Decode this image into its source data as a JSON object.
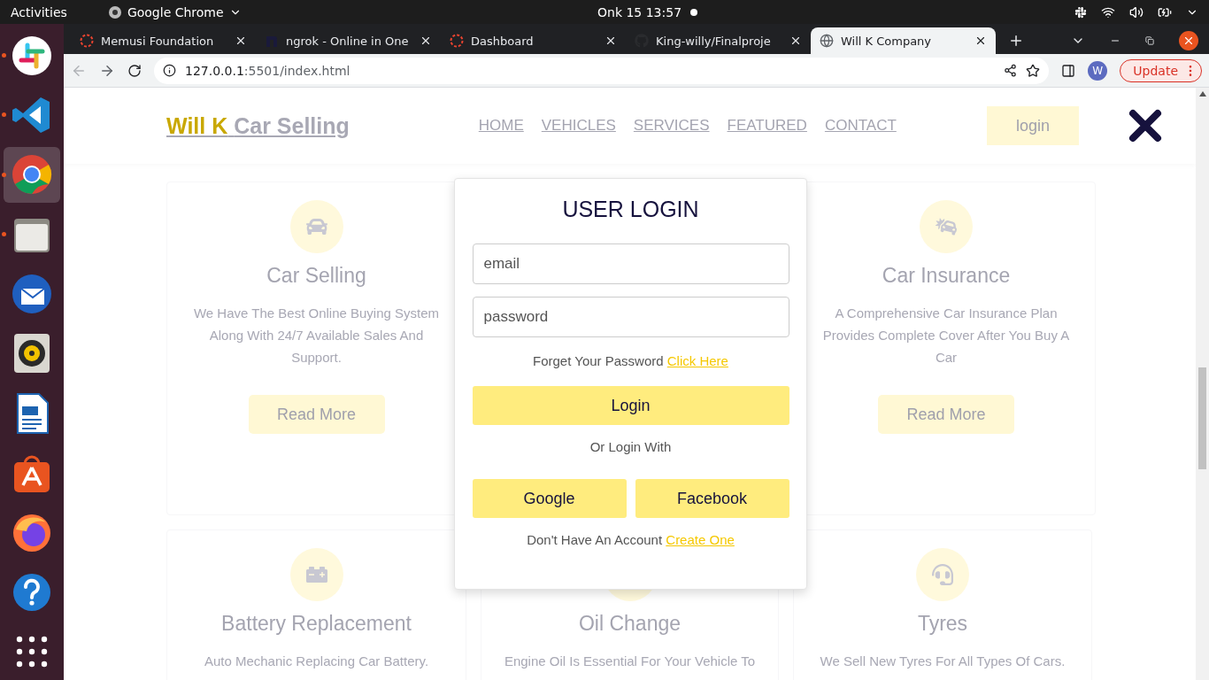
{
  "topbar": {
    "activities": "Activities",
    "app": "Google Chrome",
    "clock": "Onk 15  13:57"
  },
  "dock": [
    {
      "running": true,
      "selected": false
    },
    {
      "running": true,
      "selected": false
    },
    {
      "running": true,
      "selected": true
    },
    {
      "running": true,
      "selected": false
    },
    {
      "running": false,
      "selected": false
    },
    {
      "running": false,
      "selected": false
    },
    {
      "running": false,
      "selected": false
    },
    {
      "running": false,
      "selected": false
    },
    {
      "running": false,
      "selected": false
    },
    {
      "running": false,
      "selected": false
    },
    {
      "running": false,
      "selected": false
    }
  ],
  "tabs": [
    {
      "title": "Memusi Foundation",
      "selected": false
    },
    {
      "title": "ngrok - Online in One",
      "selected": false
    },
    {
      "title": "Dashboard",
      "selected": false
    },
    {
      "title": "King-willy/Finalproje",
      "selected": false
    },
    {
      "title": "Will K Company",
      "selected": true
    }
  ],
  "toolbar": {
    "host": "127.0.0.1",
    "path": ":5501/index.html",
    "avatar": "W",
    "update": "Update"
  },
  "header": {
    "logo_accent": "Will K",
    "logo_rest": "Car Selling",
    "nav": [
      "HOME",
      "VEHICLES",
      "SERVICES",
      "FEATURED",
      "CONTACT"
    ],
    "login": "login"
  },
  "cards_top": [
    {
      "kind": "service",
      "title": "Car Selling",
      "text": "We Have The Best Online Buying System Along With 24/7 Available Sales And Support.",
      "button": "Read More"
    },
    {
      "kind": "service",
      "title": "Car Insurance",
      "text": "A Comprehensive Car Insurance Plan Provides Complete Cover After You Buy A Car",
      "button": "Read More"
    }
  ],
  "cards_bottom": [
    {
      "kind": "service",
      "title": "Battery Replacement",
      "text": "Auto Mechanic Replacing Car Battery."
    },
    {
      "kind": "service",
      "title": "Oil Change",
      "text": "Engine Oil Is Essential For Your Vehicle To"
    },
    {
      "kind": "service",
      "title": "Tyres",
      "text": "We Sell New Tyres For All Types Of Cars."
    }
  ],
  "modal": {
    "title": "USER LOGIN",
    "email": {
      "placeholder": "email"
    },
    "password": {
      "placeholder": "password"
    },
    "forgot": "Forget Your Password",
    "forgot_link": "Click Here",
    "login": "Login",
    "or": "Or Login With",
    "social": [
      "Google",
      "Facebook"
    ],
    "signup": "Don't Have An Account",
    "signup_link": "Create One"
  }
}
